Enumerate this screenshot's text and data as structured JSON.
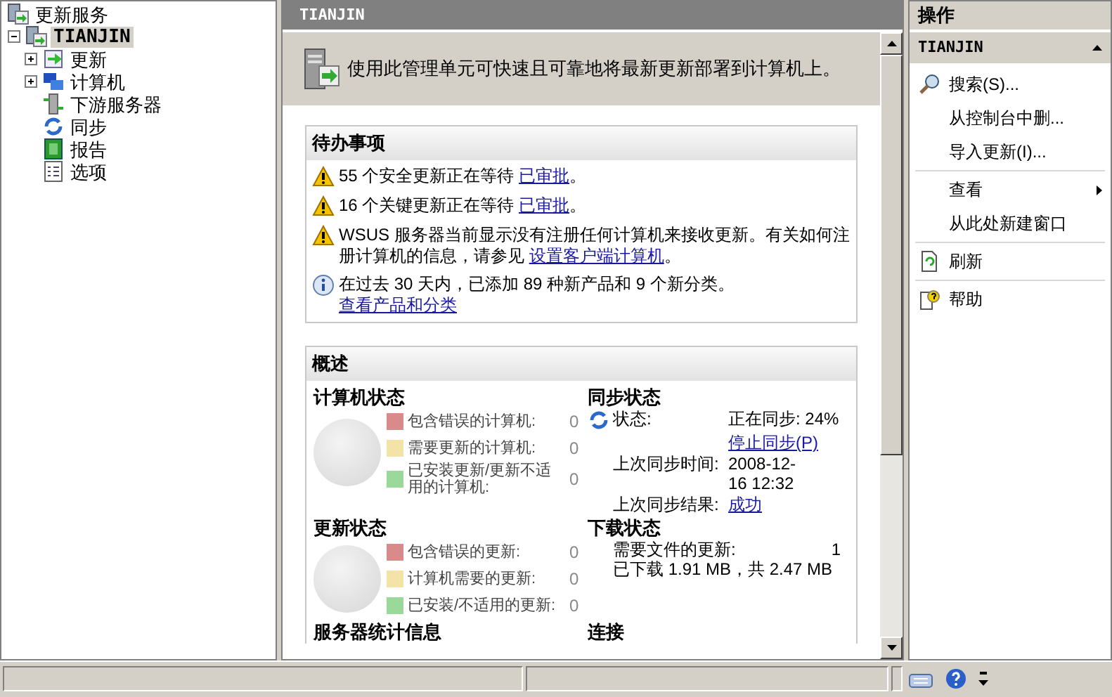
{
  "tree": {
    "label": "更新服务",
    "children": [
      {
        "label": "TIANJIN",
        "selected": true,
        "expanded": true,
        "children": [
          {
            "label": "更新",
            "expanded": false
          },
          {
            "label": "计算机",
            "expanded": false
          },
          {
            "label": "下游服务器"
          },
          {
            "label": "同步"
          },
          {
            "label": "报告"
          },
          {
            "label": "选项"
          }
        ]
      }
    ]
  },
  "center": {
    "title": "TIANJIN",
    "banner": "使用此管理单元可快速且可靠地将最新更新部署到计算机上。",
    "todo": {
      "title": "待办事项",
      "items": [
        {
          "kind": "warning",
          "text": "55 个安全更新正在等待 ",
          "link": "已审批",
          "after": "。"
        },
        {
          "kind": "warning",
          "text": "16 个关键更新正在等待 ",
          "link": "已审批",
          "after": "。"
        },
        {
          "kind": "warning",
          "text": "WSUS 服务器当前显示没有注册任何计算机来接收更新。有关如何注册计算机的信息，请参见 ",
          "link": "设置客户端计算机",
          "after": "。"
        },
        {
          "kind": "info",
          "text": "在过去 30 天内，已添加 89 种新产品和 9 个新分类。",
          "link": "查看产品和分类"
        }
      ]
    },
    "overview": {
      "title": "概述",
      "computer_status": {
        "title": "计算机状态",
        "rows": [
          {
            "label": "包含错误的计算机:",
            "value": "0",
            "color": "#d98a8a"
          },
          {
            "label": "需要更新的计算机:",
            "value": "0",
            "color": "#f3e3a6"
          },
          {
            "label": "已安装更新/更新不适用的计算机:",
            "value": "0",
            "color": "#9bd99b"
          }
        ]
      },
      "sync_status": {
        "title": "同步状态",
        "status_label": "状态:",
        "status_value": "正在同步: 24%",
        "stop_link": "停止同步(P)",
        "time_label": "上次同步时间:",
        "time_value": "2008-12-16 12:32",
        "result_label": "上次同步结果:",
        "result_link": "成功"
      },
      "update_status": {
        "title": "更新状态",
        "rows": [
          {
            "label": "包含错误的更新:",
            "value": "0",
            "color": "#d98a8a"
          },
          {
            "label": "计算机需要的更新:",
            "value": "0",
            "color": "#f3e3a6"
          },
          {
            "label": "已安装/不适用的更新:",
            "value": "0",
            "color": "#9bd99b"
          }
        ]
      },
      "download_status": {
        "title": "下载状态",
        "rows": [
          {
            "label": "需要文件的更新:",
            "value": "1"
          }
        ],
        "summary": "已下载 1.91 MB，共 2.47 MB"
      },
      "more_headings": [
        "服务器统计信息",
        "连接"
      ]
    }
  },
  "actions": {
    "title": "操作",
    "section": "TIANJIN",
    "groups": [
      [
        {
          "kind": "search",
          "label": "搜索(S)..."
        },
        {
          "kind": "plain",
          "label": "从控制台中删..."
        },
        {
          "kind": "plain",
          "label": "导入更新(I)..."
        }
      ],
      [
        {
          "kind": "submenu",
          "label": "查看"
        },
        {
          "kind": "plain",
          "label": "从此处新建窗口"
        }
      ],
      [
        {
          "kind": "refresh",
          "label": "刷新"
        }
      ],
      [
        {
          "kind": "help",
          "label": "帮助"
        }
      ]
    ]
  }
}
